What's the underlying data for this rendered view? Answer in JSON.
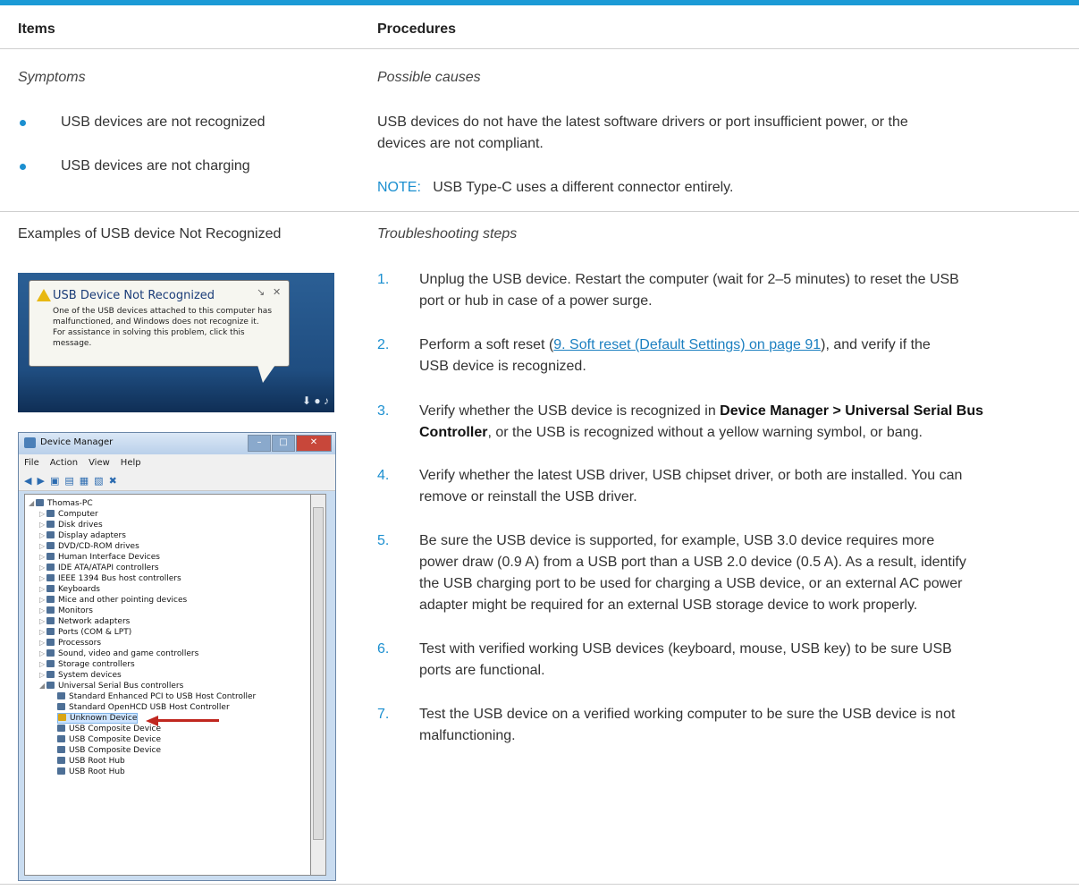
{
  "header": {
    "items": "Items",
    "procedures": "Procedures"
  },
  "row1": {
    "symptoms_label": "Symptoms",
    "symptoms": [
      "USB devices are not recognized",
      "USB devices are not charging"
    ],
    "causes_label": "Possible causes",
    "causes_line1": "USB devices do not have the latest software drivers or port insufficient power, or the",
    "causes_line2": "devices are not compliant.",
    "note_label": "NOTE:",
    "note_text": "USB Type-C uses a different connector entirely."
  },
  "row2": {
    "examples_label": "Examples of USB device Not Recognized",
    "steps_label": "Troubleshooting steps",
    "steps": [
      {
        "num": "1.",
        "l1": "Unplug the USB device. Restart the computer (wait for 2–5 minutes) to reset the USB",
        "l2": "port or hub in case of a power surge."
      },
      {
        "num": "2.",
        "pre": "Perform a soft reset (",
        "link": "9. Soft reset (Default Settings) on page 91",
        "post": "), and verify if the",
        "l2": "USB device is recognized."
      },
      {
        "num": "3.",
        "pre": "Verify whether the USB device is recognized in ",
        "bold1": "Device Manager > Universal Serial Bus",
        "bold2": "Controller",
        "rest": ", or the USB is recognized without a yellow warning symbol, or bang."
      },
      {
        "num": "4.",
        "l1": "Verify whether the latest USB driver, USB chipset driver, or both are installed. You can",
        "l2": "remove or reinstall the USB driver."
      },
      {
        "num": "5.",
        "l1": "Be sure the USB device is supported, for example, USB 3.0 device requires more",
        "l2": "power draw (0.9 A) from a USB port than a USB 2.0 device (0.5 A). As a result, identify",
        "l3": "the USB charging port to be used for charging a USB device, or an external AC power",
        "l4": "adapter might be required for an external USB storage device to work properly."
      },
      {
        "num": "6.",
        "l1": "Test with verified working USB devices (keyboard, mouse, USB key) to be sure USB",
        "l2": "ports are functional."
      },
      {
        "num": "7.",
        "l1": "Test the USB device on a verified working computer to be sure the USB device is not",
        "l2": "malfunctioning."
      }
    ]
  },
  "popup": {
    "title": "USB Device Not Recognized",
    "l1": "One of the USB devices attached to this computer has",
    "l2": "malfunctioned, and Windows does not recognize it.",
    "l3": "For assistance in solving this problem, click this",
    "l4": "message."
  },
  "devmgr": {
    "title": "Device Manager",
    "menu": [
      "File",
      "Action",
      "View",
      "Help"
    ],
    "root": "Thomas-PC",
    "nodes": [
      "Computer",
      "Disk drives",
      "Display adapters",
      "DVD/CD-ROM drives",
      "Human Interface Devices",
      "IDE ATA/ATAPI controllers",
      "IEEE 1394 Bus host controllers",
      "Keyboards",
      "Mice and other pointing devices",
      "Monitors",
      "Network adapters",
      "Ports (COM & LPT)",
      "Processors",
      "Sound, video and game controllers",
      "Storage controllers",
      "System devices",
      "Universal Serial Bus controllers"
    ],
    "usb_children": [
      "Standard Enhanced PCI to USB Host Controller",
      "Standard OpenHCD USB Host Controller",
      "Unknown Device",
      "USB Composite Device",
      "USB Composite Device",
      "USB Composite Device",
      "USB Root Hub",
      "USB Root Hub"
    ]
  }
}
